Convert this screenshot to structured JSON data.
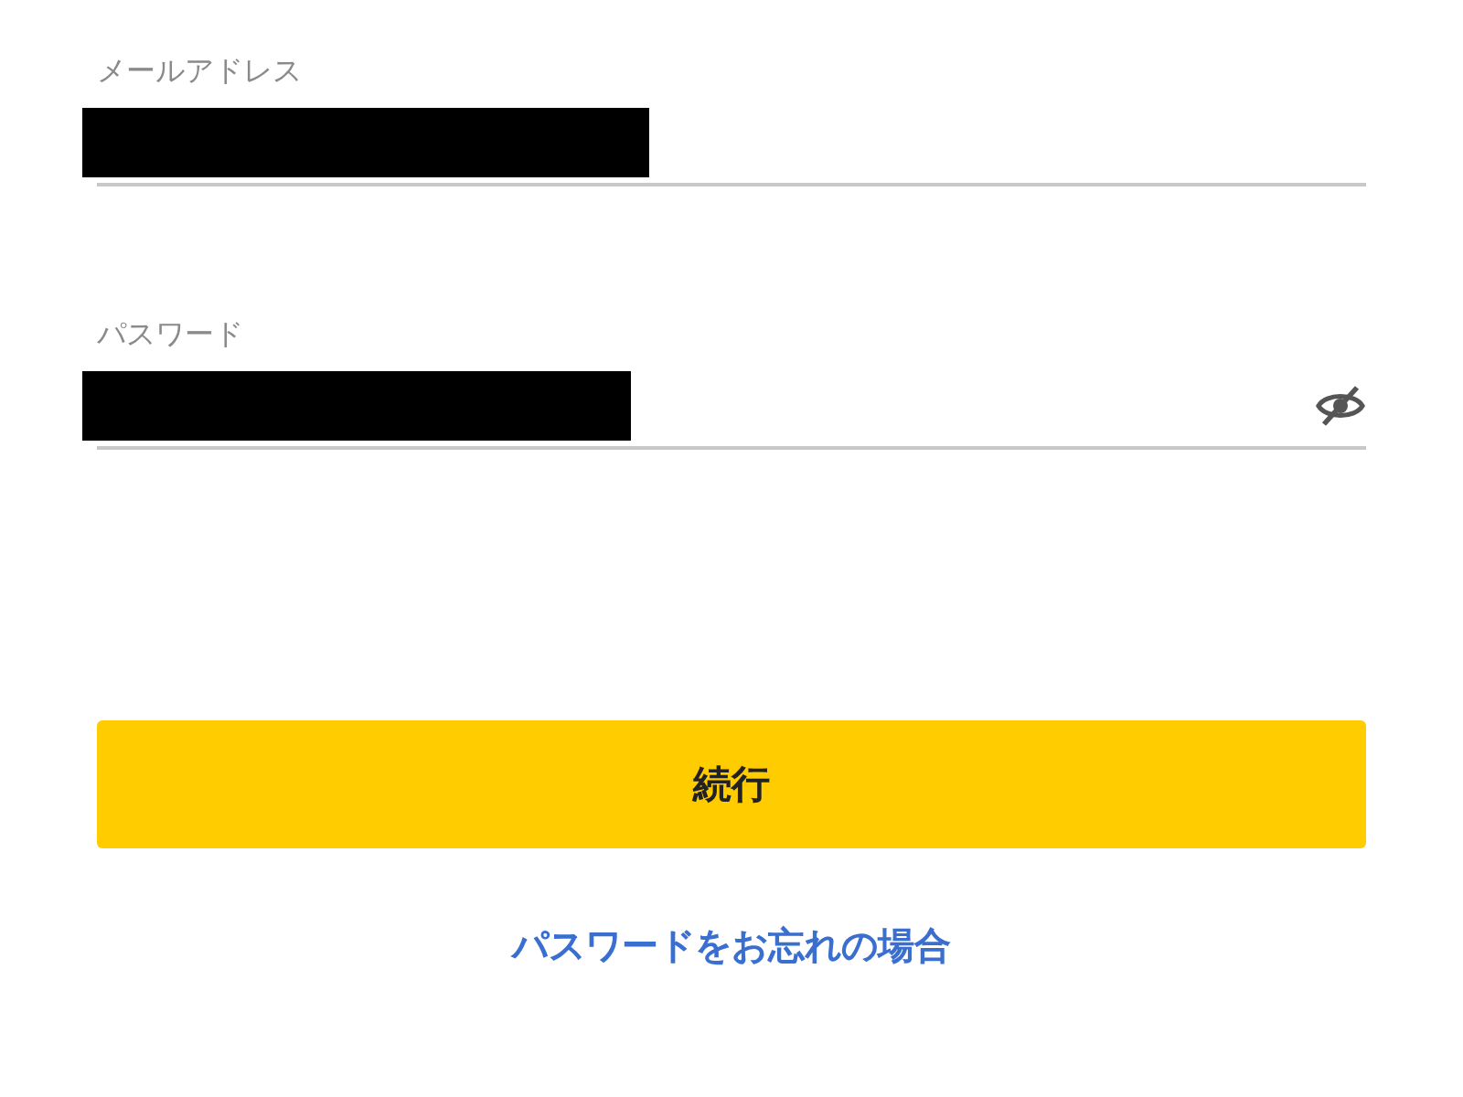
{
  "fields": [
    {
      "kind": "email",
      "label": "メールアドレス",
      "redacted": true,
      "reveal_icon": false
    },
    {
      "kind": "password",
      "label": "パスワード",
      "redacted": true,
      "reveal_icon": true
    }
  ],
  "button": {
    "label": "続行"
  },
  "link": {
    "label": "パスワードをお忘れの場合"
  }
}
